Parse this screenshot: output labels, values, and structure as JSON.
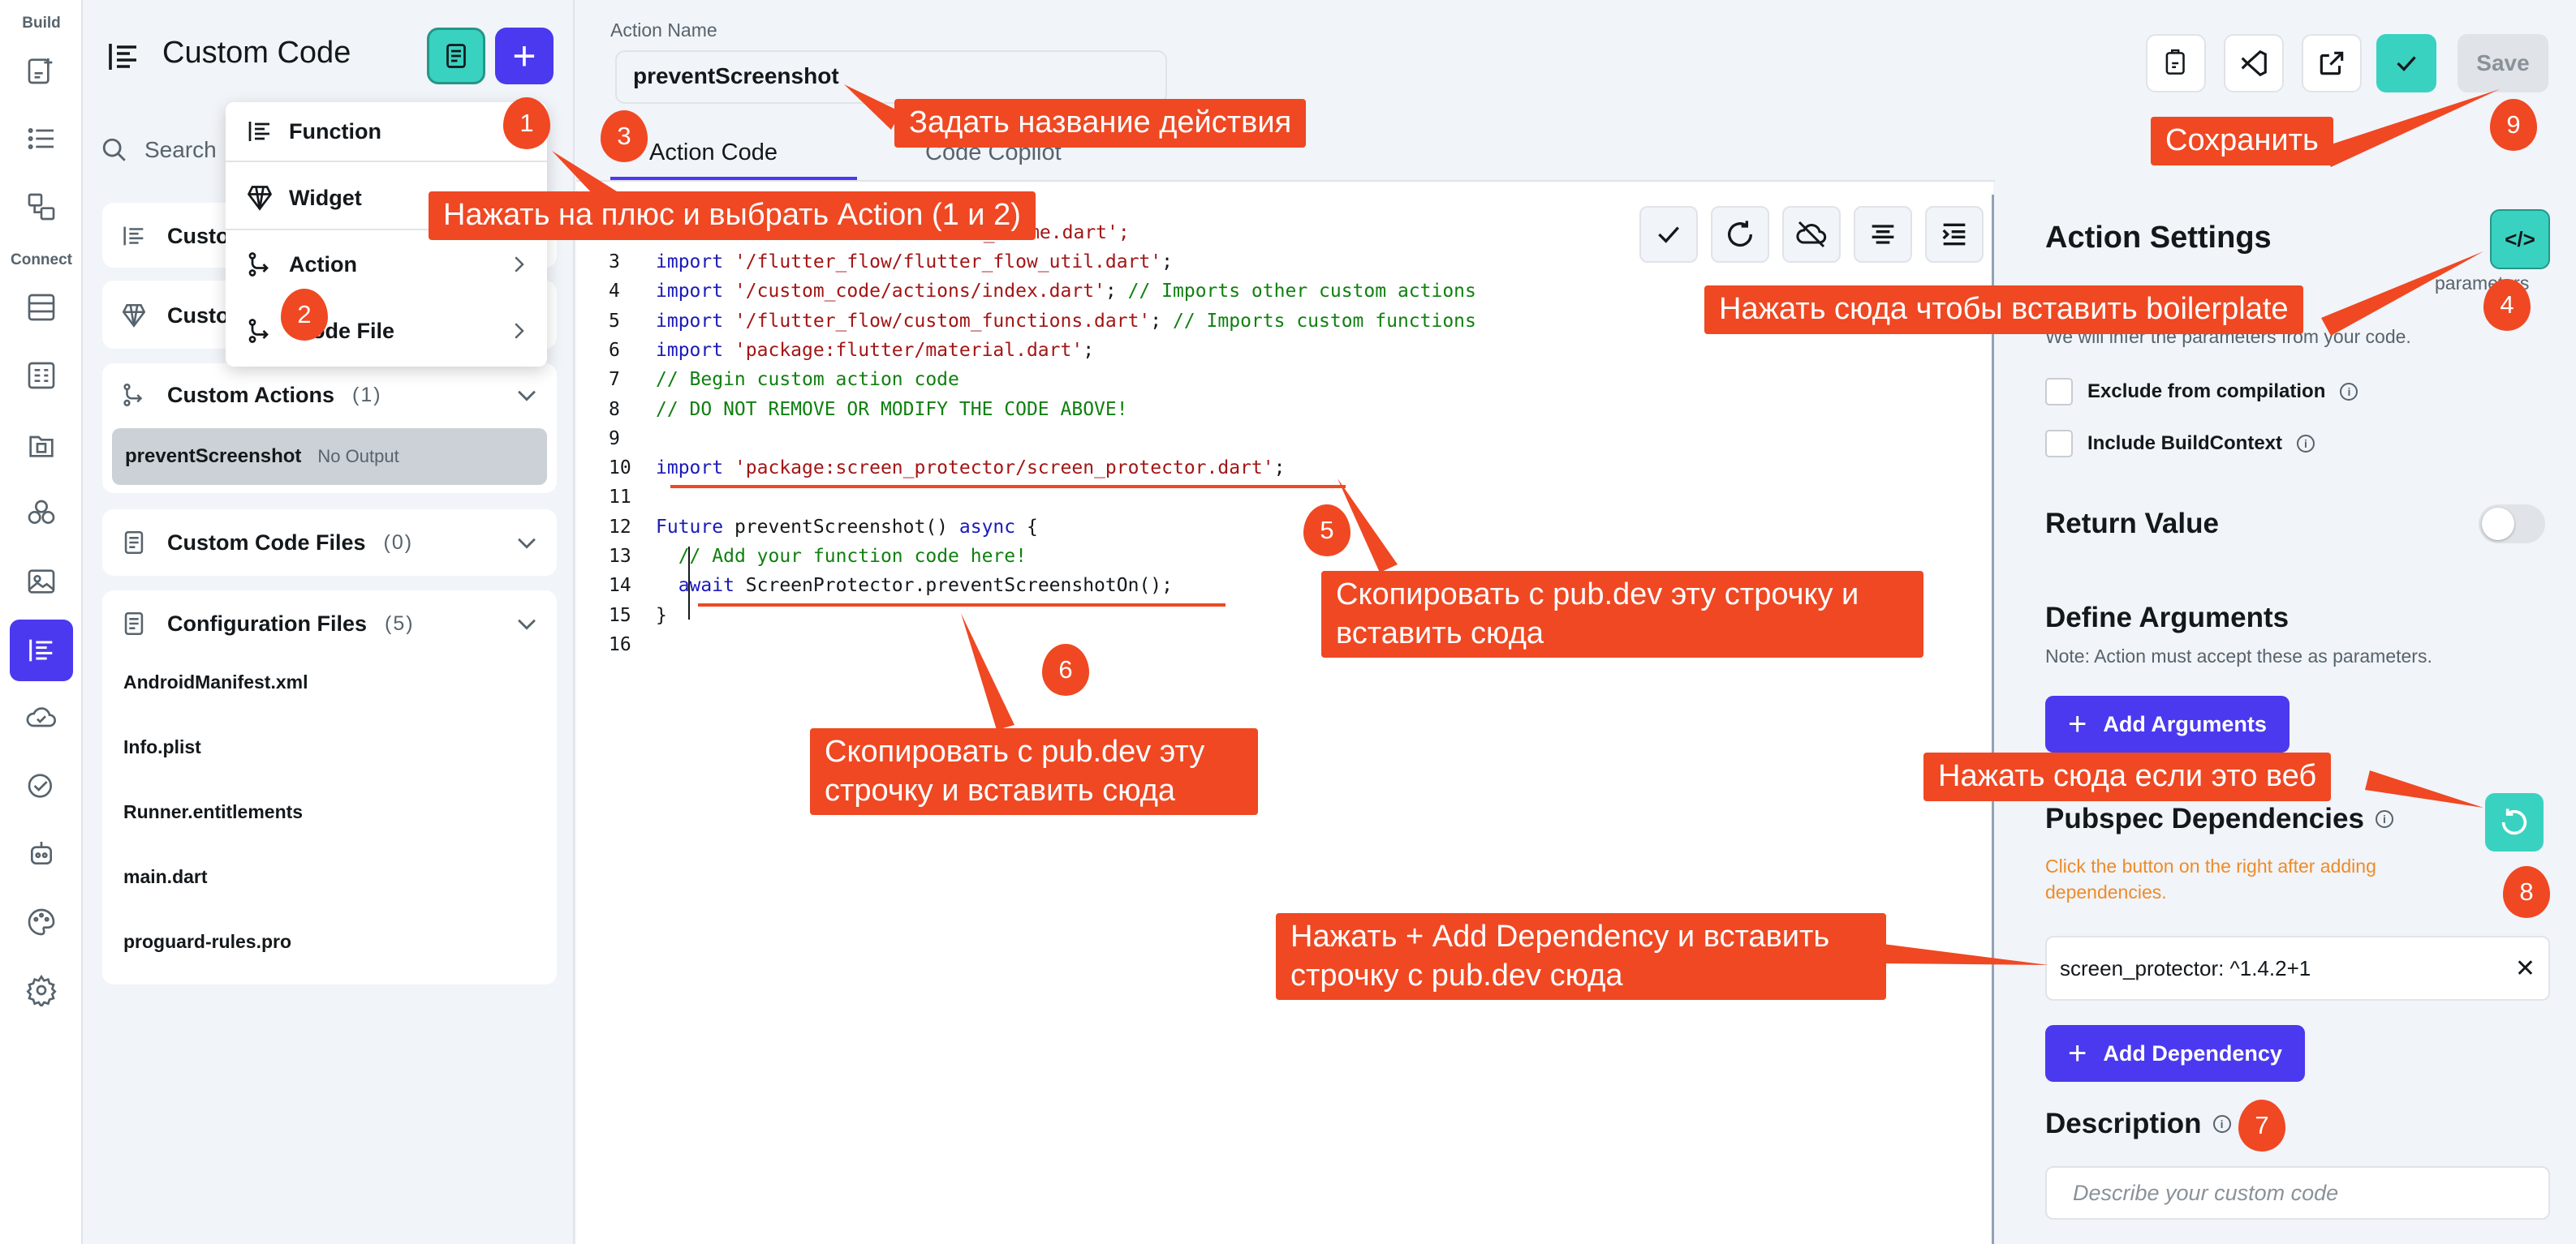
{
  "rail": {
    "build_label": "Build",
    "connect_label": "Connect"
  },
  "explorer": {
    "title": "Custom Code",
    "search_placeholder": "Search",
    "groups": [
      {
        "label": "Custom Functions"
      },
      {
        "label": "Custom Widgets"
      },
      {
        "label": "Custom Actions",
        "count": "(1)"
      },
      {
        "label": "Custom Code Files",
        "count": "(0)"
      },
      {
        "label": "Configuration Files",
        "count": "(5)"
      }
    ],
    "custom_functions_visible": "Custo",
    "custom_widgets_visible": "Custo",
    "action_item": {
      "name": "preventScreenshot",
      "tag": "No Output"
    },
    "config_files": [
      "AndroidManifest.xml",
      "Info.plist",
      "Runner.entitlements",
      "main.dart",
      "proguard-rules.pro"
    ]
  },
  "menu": {
    "items": [
      {
        "label": "Function"
      },
      {
        "label": "Widget"
      },
      {
        "label": "Action"
      },
      {
        "label": "Code File"
      }
    ],
    "code_file_visible": "ode File"
  },
  "header": {
    "action_name_label": "Action Name",
    "action_name_value": "preventScreenshot",
    "tabs": [
      {
        "label": "Action Code"
      },
      {
        "label": "Code Copilot"
      }
    ],
    "save_label": "Save"
  },
  "code": {
    "line2_tail": "ow_theme.dart';",
    "lines": [
      {
        "n": "3",
        "segs": [
          [
            "kw",
            "import "
          ],
          [
            "str",
            "'/flutter_flow/flutter_flow_util.dart'"
          ],
          [
            "",
            ";"
          ]
        ]
      },
      {
        "n": "4",
        "segs": [
          [
            "kw",
            "import "
          ],
          [
            "str",
            "'/custom_code/actions/index.dart'"
          ],
          [
            "",
            "; "
          ],
          [
            "cmt",
            "// Imports other custom actions"
          ]
        ]
      },
      {
        "n": "5",
        "segs": [
          [
            "kw",
            "import "
          ],
          [
            "str",
            "'/flutter_flow/custom_functions.dart'"
          ],
          [
            "",
            "; "
          ],
          [
            "cmt",
            "// Imports custom functions"
          ]
        ]
      },
      {
        "n": "6",
        "segs": [
          [
            "kw",
            "import "
          ],
          [
            "str",
            "'package:flutter/material.dart'"
          ],
          [
            "",
            ";"
          ]
        ]
      },
      {
        "n": "7",
        "segs": [
          [
            "cmt",
            "// Begin custom action code"
          ]
        ]
      },
      {
        "n": "8",
        "segs": [
          [
            "cmt",
            "// DO NOT REMOVE OR MODIFY THE CODE ABOVE!"
          ]
        ]
      },
      {
        "n": "9",
        "segs": []
      },
      {
        "n": "10",
        "segs": [
          [
            "kw",
            "import "
          ],
          [
            "str",
            "'package:screen_protector/screen_protector.dart'"
          ],
          [
            "",
            ";"
          ]
        ]
      },
      {
        "n": "11",
        "segs": []
      },
      {
        "n": "12",
        "segs": [
          [
            "kw",
            "Future "
          ],
          [
            "",
            "preventScreenshot() "
          ],
          [
            "kw",
            "async"
          ],
          [
            "",
            " {"
          ]
        ]
      },
      {
        "n": "13",
        "segs": [
          [
            "",
            "  "
          ],
          [
            "cmt",
            "// Add your function code here!"
          ]
        ]
      },
      {
        "n": "14",
        "segs": [
          [
            "",
            "  "
          ],
          [
            "kw",
            "await "
          ],
          [
            "",
            "ScreenProtector.preventScreenshotOn();"
          ]
        ]
      },
      {
        "n": "15",
        "segs": [
          [
            "",
            "}"
          ]
        ]
      },
      {
        "n": "16",
        "segs": []
      }
    ]
  },
  "settings": {
    "title": "Action Settings",
    "note_line1_tail": "parameters",
    "note_line2": "We will infer the parameters from your code.",
    "exclude_label": "Exclude from compilation",
    "include_context_label": "Include BuildContext",
    "return_value_title": "Return Value",
    "define_args_title": "Define Arguments",
    "define_args_note": "Note: Action must accept these as parameters.",
    "add_arguments_label": "Add Arguments",
    "pubspec_title": "Pubspec Dependencies",
    "pubspec_warning": "Click the button on the right after adding dependencies.",
    "dependency_value": "screen_protector: ^1.4.2+1",
    "add_dependency_label": "Add Dependency",
    "description_title": "Description",
    "description_placeholder": "Describe your custom code",
    "boilerplate_glyph": "</>"
  },
  "annotations": {
    "callouts": [
      "Нажать на плюс и выбрать Action (1 и 2)",
      "Задать название действия",
      "Нажать сюда чтобы вставить boilerplate",
      "Скопировать с pub.dev эту строчку и вставить сюда",
      "Скопировать с pub.dev эту строчку и вставить сюда",
      "Нажать + Add Dependency и вставить строчку с pub.dev сюда",
      "Нажать сюда если это веб",
      "Сохранить"
    ],
    "markers": [
      "1",
      "2",
      "3",
      "4",
      "5",
      "6",
      "7",
      "8",
      "9"
    ],
    "color": "#ef4823"
  },
  "colors": {
    "primary": "#4b39ef",
    "secondary": "#39d2c0",
    "background": "#f1f4f8",
    "warning": "#ee8b28"
  }
}
